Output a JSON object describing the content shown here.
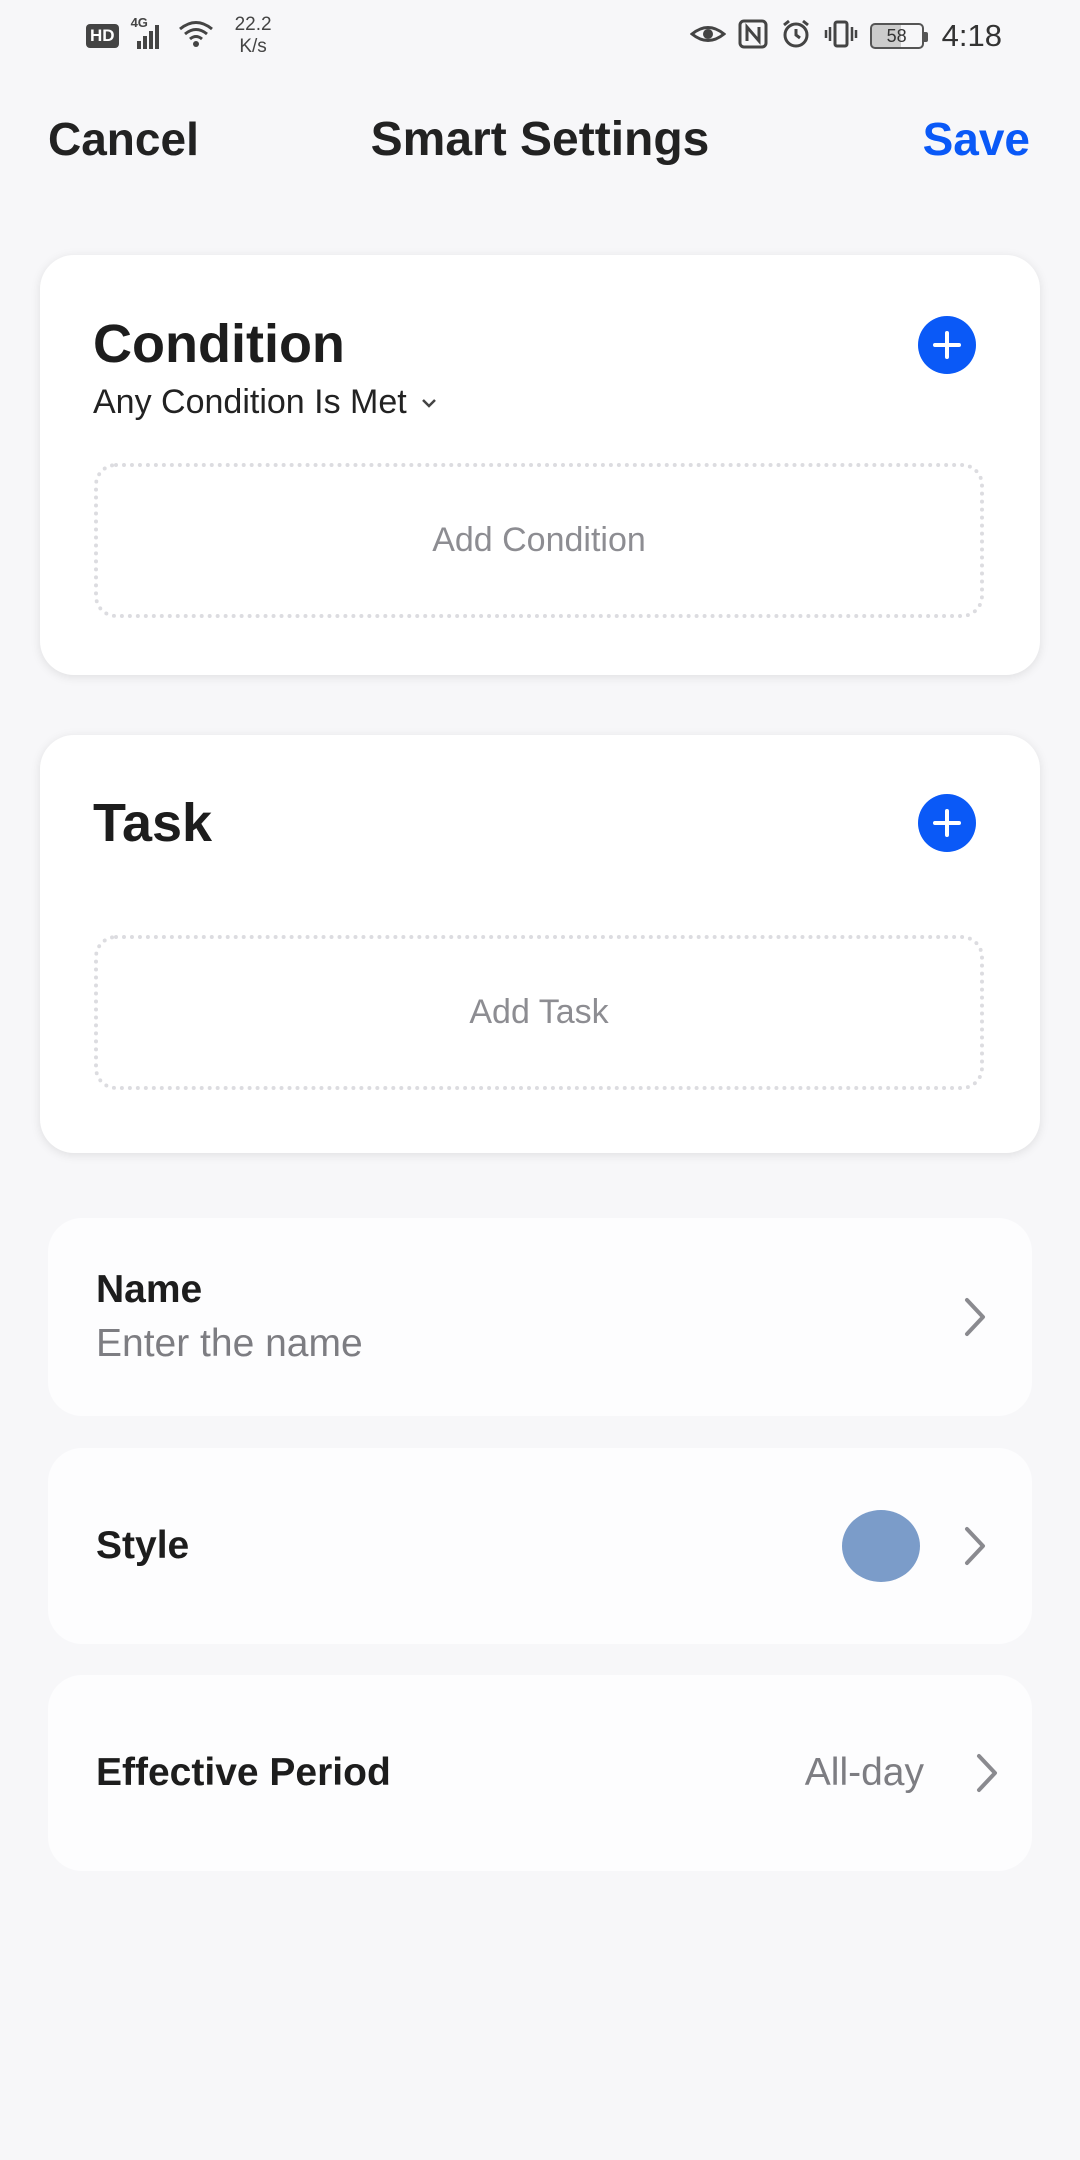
{
  "status_bar": {
    "hd": "HD",
    "network": "4G",
    "speed_value": "22.2",
    "speed_unit": "K/s",
    "battery": "58",
    "time": "4:18"
  },
  "header": {
    "cancel": "Cancel",
    "title": "Smart Settings",
    "save": "Save"
  },
  "condition": {
    "title": "Condition",
    "mode": "Any Condition Is Met",
    "add_label": "Add Condition"
  },
  "task": {
    "title": "Task",
    "add_label": "Add Task"
  },
  "name_row": {
    "label": "Name",
    "placeholder": "Enter the name"
  },
  "style_row": {
    "label": "Style",
    "color": "#7b9cc9"
  },
  "period_row": {
    "label": "Effective Period",
    "value": "All-day"
  },
  "colors": {
    "accent": "#0a59f7",
    "background": "#f7f7f9"
  }
}
